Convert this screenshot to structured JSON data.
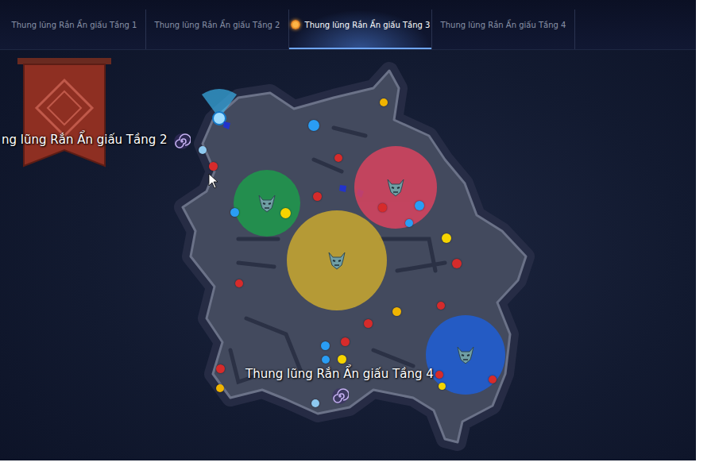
{
  "tabs": [
    {
      "label": "Thung lũng Rắn Ẩn giấu Tầng 1",
      "selected": false
    },
    {
      "label": "Thung lũng Rắn Ẩn giấu Tầng 2",
      "selected": false
    },
    {
      "label": "Thung lũng Rắn Ẩn giấu Tầng 3",
      "selected": true
    },
    {
      "label": "Thung lũng Rắn Ẩn giấu Tầng 4",
      "selected": false
    }
  ],
  "map": {
    "portals": [
      {
        "label": "ng lũng Rắn Ẩn giấu Tầng 2"
      },
      {
        "label": "Thung lũng Rắn Ẩn giấu Tầng 4"
      }
    ],
    "zones": [
      {
        "color": "#1e9a4c"
      },
      {
        "color": "#d9435f"
      },
      {
        "color": "#c9a830"
      },
      {
        "color": "#1f5fd6"
      }
    ],
    "markers": [
      {
        "color": "#f0b400"
      },
      {
        "color": "#2a9df4"
      },
      {
        "color": "#8ec9f0"
      },
      {
        "color": "#d62b2b"
      },
      {
        "color": "#d62b2b"
      },
      {
        "color": "#d62b2b"
      },
      {
        "color": "#2a9df4"
      },
      {
        "color": "#f5d400"
      },
      {
        "color": "#d62b2b"
      },
      {
        "color": "#2a9df4"
      },
      {
        "color": "#2a9df4"
      },
      {
        "color": "#f5d400"
      },
      {
        "color": "#d62b2b"
      },
      {
        "color": "#d62b2b"
      },
      {
        "color": "#f0b400"
      },
      {
        "color": "#d62b2b"
      },
      {
        "color": "#d62b2b"
      },
      {
        "color": "#d62b2b"
      },
      {
        "color": "#2a9df4"
      },
      {
        "color": "#2a9df4"
      },
      {
        "color": "#f5d400"
      },
      {
        "color": "#d62b2b"
      },
      {
        "color": "#f0b400"
      },
      {
        "color": "#d62b2b"
      },
      {
        "color": "#d62b2b"
      },
      {
        "color": "#f5d400"
      },
      {
        "color": "#8ec9f0"
      }
    ]
  }
}
